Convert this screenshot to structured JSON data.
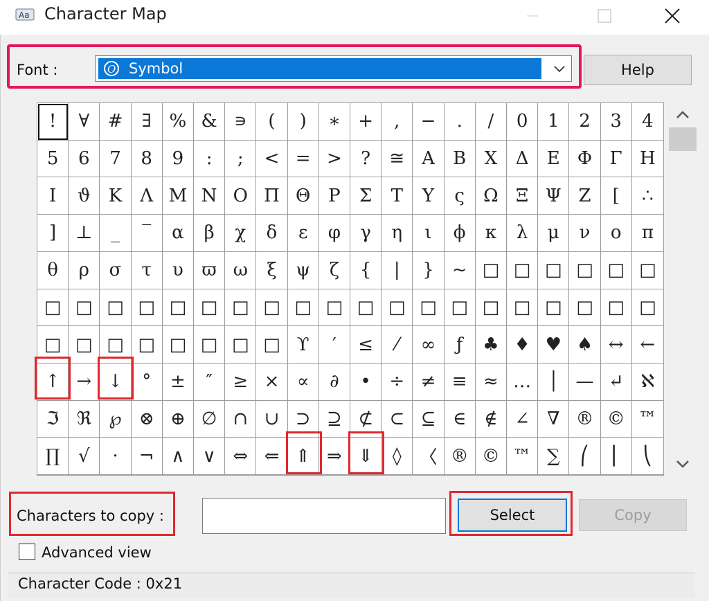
{
  "window": {
    "title": "Character Map"
  },
  "font": {
    "label": "Font :",
    "selected": "Symbol"
  },
  "buttons": {
    "help": "Help",
    "select": "Select",
    "copy": "Copy"
  },
  "grid": {
    "rows": [
      [
        "!",
        "∀",
        "#",
        "∃",
        "%",
        "&",
        "∍",
        "(",
        ")",
        "∗",
        "+",
        ",",
        "−",
        ".",
        "/",
        "0",
        "1",
        "2",
        "3",
        "4"
      ],
      [
        "5",
        "6",
        "7",
        "8",
        "9",
        ":",
        ";",
        "<",
        "=",
        ">",
        "?",
        "≅",
        "Α",
        "Β",
        "Χ",
        "Δ",
        "Ε",
        "Φ",
        "Γ",
        "Η"
      ],
      [
        "Ι",
        "ϑ",
        "Κ",
        "Λ",
        "Μ",
        "Ν",
        "Ο",
        "Π",
        "Θ",
        "Ρ",
        "Σ",
        "Τ",
        "Υ",
        "ς",
        "Ω",
        "Ξ",
        "Ψ",
        "Ζ",
        "[",
        "∴"
      ],
      [
        "]",
        "⊥",
        "_",
        "‾",
        "α",
        "β",
        "χ",
        "δ",
        "ε",
        "φ",
        "γ",
        "η",
        "ι",
        "ϕ",
        "κ",
        "λ",
        "μ",
        "ν",
        "ο",
        "π"
      ],
      [
        "θ",
        "ρ",
        "σ",
        "τ",
        "υ",
        "ϖ",
        "ω",
        "ξ",
        "ψ",
        "ζ",
        "{",
        "|",
        "}",
        "~",
        "□",
        "□",
        "□",
        "□",
        "□",
        "□"
      ],
      [
        "□",
        "□",
        "□",
        "□",
        "□",
        "□",
        "□",
        "□",
        "□",
        "□",
        "□",
        "□",
        "□",
        "□",
        "□",
        "□",
        "□",
        "□",
        "□",
        "□"
      ],
      [
        "□",
        "□",
        "□",
        "□",
        "□",
        "□",
        "□",
        "□",
        "ϒ",
        "′",
        "≤",
        "⁄",
        "∞",
        "ƒ",
        "♣",
        "♦",
        "♥",
        "♠",
        "↔",
        "←"
      ],
      [
        "↑",
        "→",
        "↓",
        "°",
        "±",
        "″",
        "≥",
        "×",
        "∝",
        "∂",
        "•",
        "÷",
        "≠",
        "≡",
        "≈",
        "…",
        "│",
        "—",
        "↵",
        "ℵ"
      ],
      [
        "ℑ",
        "ℜ",
        "℘",
        "⊗",
        "⊕",
        "∅",
        "∩",
        "∪",
        "⊃",
        "⊇",
        "⊄",
        "⊂",
        "⊆",
        "∈",
        "∉",
        "∠",
        "∇",
        "®",
        "©",
        "™"
      ],
      [
        "∏",
        "√",
        "·",
        "¬",
        "∧",
        "∨",
        "⇔",
        "⇐",
        "⇑",
        "⇒",
        "⇓",
        "◊",
        "〈",
        "®",
        "©",
        "™",
        "∑",
        "⎛",
        "⎜",
        "⎝"
      ]
    ]
  },
  "characters_to_copy": {
    "label": "Characters to copy :",
    "value": ""
  },
  "advanced_view": {
    "label": "Advanced view",
    "checked": false
  },
  "status": {
    "text": "Character Code : 0x21"
  },
  "colors": {
    "highlight": "#e4175c",
    "selection": "#0b78d7"
  }
}
